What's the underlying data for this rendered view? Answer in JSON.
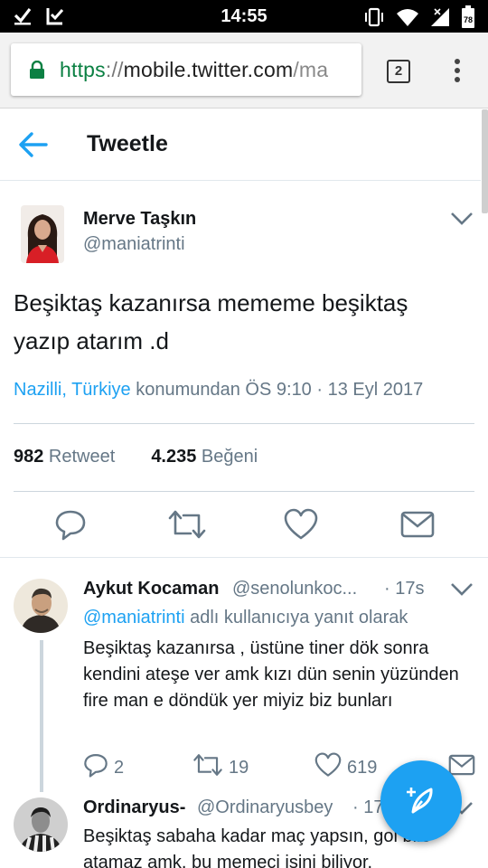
{
  "status_bar": {
    "time": "14:55",
    "battery_level": "78",
    "left_icons": [
      "check-icon",
      "clipboard-check-icon"
    ],
    "right_icons": [
      "vibrate-icon",
      "wifi-icon",
      "signal-icon",
      "battery-icon"
    ]
  },
  "browser": {
    "url_scheme": "https",
    "url_sep": "://",
    "url_host": "mobile.twitter.com",
    "url_path": "/ma",
    "tab_count": "2",
    "secure_color": "#0b8043"
  },
  "header": {
    "title": "Tweetle"
  },
  "tweet": {
    "display_name": "Merve Taşkın",
    "handle": "@maniatrinti",
    "text": "Beşiktaş kazanırsa mememe beşiktaş yazıp atarım .d",
    "location": "Nazilli, Türkiye",
    "location_suffix": " konumundan ÖS 9:10 · 13 Eyl 2017",
    "retweet_count": "982",
    "retweet_label": " Retweet",
    "like_count": "4.235",
    "like_label": " Beğeni"
  },
  "replies": [
    {
      "display_name": "Aykut Kocaman",
      "handle": "@senolunkoc...",
      "time": "· 17s",
      "reply_to_mention": "@maniatrinti",
      "reply_to_suffix": " adlı kullanıcıya yanıt olarak",
      "text": "Beşiktaş kazanırsa , üstüne tiner dök sonra kendini ateşe ver amk kızı dün senin yüzünden fire man e döndük yer miyiz biz bunları",
      "reply_count": "2",
      "retweet_count": "19",
      "like_count": "619"
    },
    {
      "display_name": "Ordinaryus-",
      "handle": "@Ordinaryusbey",
      "time": "· 17",
      "text": "Beşiktaş sabaha kadar maç yapsın, gol bile atamaz amk. bu memeci işini biliyor."
    }
  ],
  "colors": {
    "accent": "#1da1f2",
    "text_primary": "#14171a",
    "text_secondary": "#657786",
    "divider": "#ccd6dd"
  }
}
